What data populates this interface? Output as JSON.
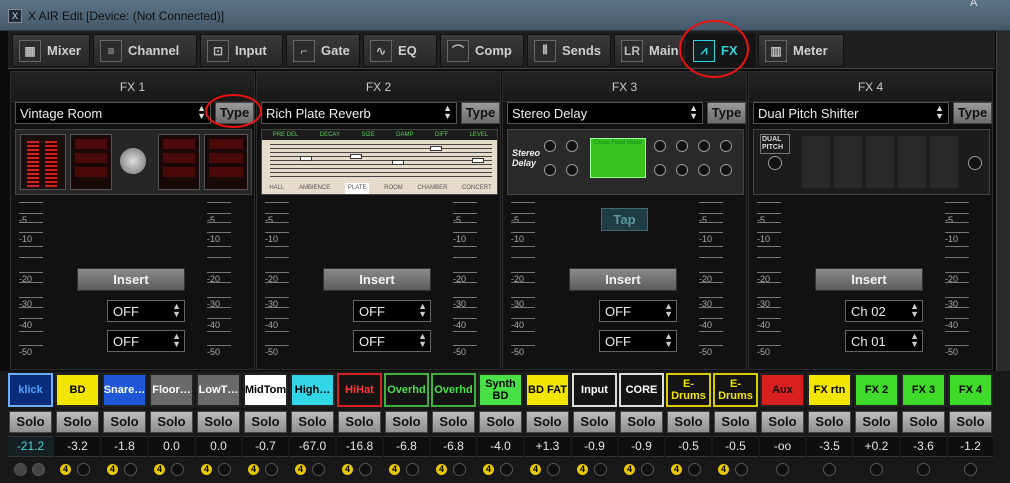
{
  "window": {
    "title": "X AIR Edit [Device: (Not Connected)]",
    "right_fragment": "A"
  },
  "tabs": [
    {
      "label": "Mixer",
      "icon": "mixer-grid-icon"
    },
    {
      "label": "Channel",
      "icon": "channel-sliders-icon"
    },
    {
      "label": "Input",
      "icon": "input-icon"
    },
    {
      "label": "Gate",
      "icon": "gate-curve-icon"
    },
    {
      "label": "EQ",
      "icon": "eq-curve-icon"
    },
    {
      "label": "Comp",
      "icon": "comp-curve-icon"
    },
    {
      "label": "Sends",
      "icon": "sends-sliders-icon"
    },
    {
      "label": "Main",
      "icon": "main-lr-icon"
    },
    {
      "label": "FX",
      "icon": "fx-wave-icon"
    },
    {
      "label": "Meter",
      "icon": "meter-bars-icon"
    }
  ],
  "active_tab": "FX",
  "meter_scale": [
    "-5",
    "-10",
    "-20",
    "-30",
    "-40",
    "-50"
  ],
  "fx_panels": [
    {
      "title": "FX 1",
      "effect": "Vintage Room",
      "type_label": "Type",
      "insert_label": "Insert",
      "dropdown1": "OFF",
      "dropdown2": "OFF",
      "show_tap": false
    },
    {
      "title": "FX 2",
      "effect": "Rich Plate Reverb",
      "type_label": "Type",
      "insert_label": "Insert",
      "dropdown1": "OFF",
      "dropdown2": "OFF",
      "show_tap": false,
      "image_labels": [
        "PRE DEL",
        "DECAY",
        "SIZE",
        "DAMP",
        "DIFF",
        "LEVEL"
      ],
      "image_buttons": [
        "HALL",
        "AMBIENCE",
        "PLATE",
        "ROOM",
        "CHAMBER",
        "CONCERT"
      ]
    },
    {
      "title": "FX 3",
      "effect": "Stereo Delay",
      "type_label": "Type",
      "insert_label": "Insert",
      "dropdown1": "OFF",
      "dropdown2": "OFF",
      "show_tap": true,
      "tap_label": "Tap",
      "image_name": "Stereo Delay",
      "image_mode": "Cross Feed Mode"
    },
    {
      "title": "FX 4",
      "effect": "Dual Pitch Shifter",
      "type_label": "Type",
      "insert_label": "Insert",
      "dropdown1": "Ch 02",
      "dropdown2": "Ch 01",
      "show_tap": false,
      "image_name": "DUAL PITCH"
    }
  ],
  "channels": [
    {
      "name": "klick",
      "bg": "#0a2a7a",
      "fg": "#4aa8ff",
      "gain": "-21.2",
      "selected": true
    },
    {
      "name": "BD",
      "bg": "#f2e600",
      "fg": "#000000",
      "gain": "-3.2"
    },
    {
      "name": "Snare…",
      "bg": "#1f57d8",
      "fg": "#ffffff",
      "gain": "-1.8"
    },
    {
      "name": "Floor…",
      "bg": "#6a6a6a",
      "fg": "#ffffff",
      "gain": "0.0"
    },
    {
      "name": "LowT…",
      "bg": "#6a6a6a",
      "fg": "#ffffff",
      "gain": "0.0"
    },
    {
      "name": "MidTom",
      "bg": "#ffffff",
      "fg": "#000000",
      "gain": "-0.7"
    },
    {
      "name": "High…",
      "bg": "#33d6e6",
      "fg": "#000000",
      "gain": "-67.0"
    },
    {
      "name": "HiHat",
      "bg": "#141414",
      "fg": "#ff3b3b",
      "border": "#d32020",
      "gain": "-16.8"
    },
    {
      "name": "Overhd",
      "bg": "#141414",
      "fg": "#49e049",
      "border": "#3db03d",
      "gain": "-6.8"
    },
    {
      "name": "Overhd",
      "bg": "#141414",
      "fg": "#49e049",
      "border": "#3db03d",
      "gain": "-6.8"
    },
    {
      "name": "Synth BD",
      "bg": "#4ae048",
      "fg": "#000000",
      "gain": "-4.0"
    },
    {
      "name": "BD FAT",
      "bg": "#f2e600",
      "fg": "#000000",
      "gain": "+1.3"
    },
    {
      "name": "Input",
      "bg": "#141414",
      "fg": "#ffffff",
      "border": "#dddddd",
      "gain": "-0.9"
    },
    {
      "name": "CORE",
      "bg": "#141414",
      "fg": "#ffffff",
      "border": "#dddddd",
      "gain": "-0.9"
    },
    {
      "name": "E-Drums",
      "bg": "#141414",
      "fg": "#f2e600",
      "border": "#d8cc00",
      "gain": "-0.5"
    },
    {
      "name": "E-Drums",
      "bg": "#141414",
      "fg": "#f2e600",
      "border": "#d8cc00",
      "gain": "-0.5"
    },
    {
      "name": "Aux",
      "bg": "#d82020",
      "fg": "#111111",
      "gain": "-oo"
    },
    {
      "name": "FX rtn",
      "bg": "#f2e600",
      "fg": "#000000",
      "gain": "-3.5"
    },
    {
      "name": "FX 2",
      "bg": "#3fda2a",
      "fg": "#000000",
      "gain": "+0.2"
    },
    {
      "name": "FX 3",
      "bg": "#3fda2a",
      "fg": "#000000",
      "gain": "-3.6"
    },
    {
      "name": "FX 4",
      "bg": "#3fda2a",
      "fg": "#000000",
      "gain": "-1.2"
    }
  ],
  "solo_label": "Solo",
  "badge_label": "4",
  "colors": {
    "accent": "#2fd3dd",
    "annotation": "#e11111"
  }
}
